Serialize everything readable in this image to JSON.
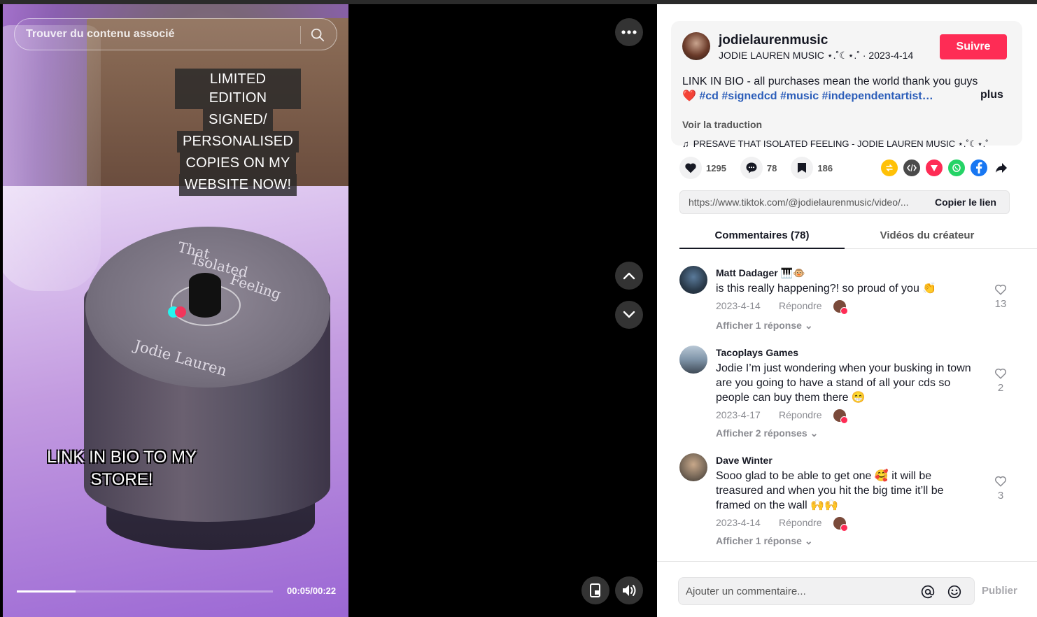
{
  "search": {
    "placeholder": "Trouver du contenu associé"
  },
  "video": {
    "caption_lines": [
      "LIMITED EDITION",
      "SIGNED/",
      "PERSONALISED",
      "COPIES ON MY",
      "WEBSITE NOW!"
    ],
    "overlay_lines": [
      "LINK IN BIO TO MY",
      "STORE!"
    ],
    "disc_text": {
      "line1": "That",
      "line2": "Isolated",
      "line3": "Feeling",
      "line4": "Jodie Lauren"
    },
    "time": "00:05/00:22",
    "progress": 0.23
  },
  "post": {
    "username": "jodielaurenmusic",
    "subline": "JODIE LAUREN MUSIC ⋆.˚☾⋆.˚ · 2023-4-14",
    "follow_label": "Suivre",
    "desc_text": "LINK IN BIO - all purchases mean the world⁣⁣ thank you guys",
    "desc_heart": "❤️",
    "hashtags": "#cd #signedcd #music #independentartist…",
    "more_label": "plus",
    "translate_label": "Voir la traduction",
    "music": "PRESAVE THAT ISOLATED FEELING - JODIE LAUREN MUSIC ⋆.˚☾⋆.˚"
  },
  "actions": {
    "likes": "1295",
    "comments": "78",
    "saves": "186"
  },
  "share_icons": [
    "repost-icon",
    "embed-icon",
    "send-icon",
    "whatsapp-icon",
    "facebook-icon",
    "share-arrow-icon"
  ],
  "link": {
    "url": "https://www.tiktok.com/@jodielaurenmusic/video/...",
    "copy_label": "Copier le lien"
  },
  "tabs": {
    "comments": "Commentaires (78)",
    "videos": "Vidéos du créateur"
  },
  "comments": [
    {
      "name": "Matt Dadager 🎹🐵",
      "text": "is this really happening?! so proud of you 👏",
      "date": "2023-4-14",
      "reply": "Répondre",
      "show": "Afficher 1 réponse",
      "likes": "13"
    },
    {
      "name": "Tacoplays Games",
      "text": "Jodie I’m just wondering when your busking in town are you going to have a stand of all your cds so people can buy them there 😁",
      "date": "2023-4-17",
      "reply": "Répondre",
      "show": "Afficher 2 réponses",
      "likes": "2"
    },
    {
      "name": "Dave Winter",
      "text": "Sooo glad to be able to get one 🥰 it will be treasured and when you hit the big time it’ll be framed on the wall 🙌🙌",
      "date": "2023-4-14",
      "reply": "Répondre",
      "show": "Afficher 1 réponse",
      "likes": "3"
    }
  ],
  "footer": {
    "placeholder": "Ajouter un commentaire...",
    "publish": "Publier"
  },
  "colors": {
    "accent": "#fe2c55",
    "hashtag": "#2b5db9",
    "text": "#161823",
    "muted": "#8a8b91"
  }
}
